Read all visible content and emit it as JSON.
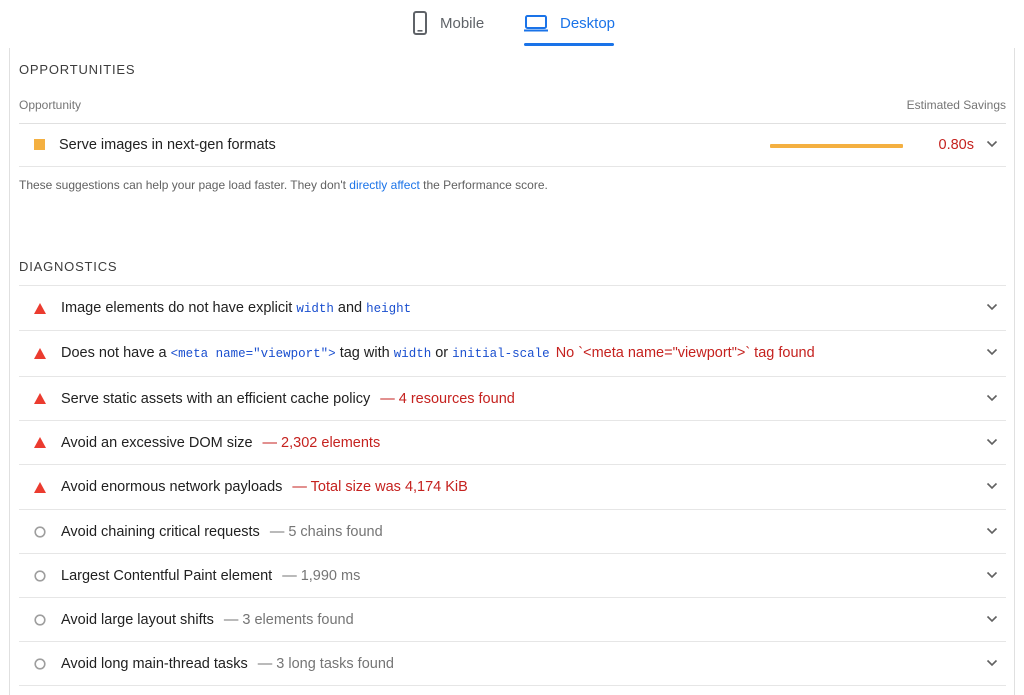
{
  "tabs": {
    "mobile": {
      "label": "Mobile",
      "icon": "phone-icon"
    },
    "desktop": {
      "label": "Desktop",
      "icon": "laptop-icon",
      "selected": true
    }
  },
  "opportunities": {
    "section_title": "OPPORTUNITIES",
    "col_left": "Opportunity",
    "col_right": "Estimated Savings",
    "items": [
      {
        "title": "Serve images in next-gen formats",
        "savings": "0.80s",
        "savings_fraction": 1.0,
        "icon": "orange-square-icon",
        "bar_color": "#f4b041"
      }
    ],
    "note": {
      "before": "These suggestions can help your page load faster. They don't ",
      "link": "directly affect",
      "after": " the Performance score."
    }
  },
  "diagnostics": {
    "section_title": "DIAGNOSTICS",
    "items": [
      {
        "severity": "fail",
        "t1": "Image elements do not have explicit ",
        "c1": "width",
        "t2": " and ",
        "c2": "height"
      },
      {
        "severity": "fail",
        "t1": "Does not have a ",
        "c1": "<meta name=\"viewport\">",
        "t2": " tag with ",
        "c2": "width",
        "t3": " or ",
        "c3": "initial-scale",
        "display": "No `<meta name=\"viewport\">` tag found"
      },
      {
        "severity": "fail",
        "t1": "Serve static assets with an efficient cache policy",
        "display": "— 4 resources found"
      },
      {
        "severity": "fail",
        "t1": "Avoid an excessive DOM size",
        "display": "— 2,302 elements"
      },
      {
        "severity": "fail",
        "t1": "Avoid enormous network payloads",
        "display": "— Total size was 4,174 KiB"
      },
      {
        "severity": "info",
        "t1": "Avoid chaining critical requests",
        "display": "— 5 chains found"
      },
      {
        "severity": "info",
        "t1": "Largest Contentful Paint element",
        "display": "— 1,990 ms"
      },
      {
        "severity": "info",
        "t1": "Avoid large layout shifts",
        "display": "— 3 elements found"
      },
      {
        "severity": "info",
        "t1": "Avoid long main-thread tasks",
        "display": "— 3 long tasks found"
      }
    ]
  },
  "colors": {
    "accent": "#1a73e8",
    "fail": "#eb3b2f",
    "average": "#f4b041",
    "fail_text": "#c5221f"
  }
}
